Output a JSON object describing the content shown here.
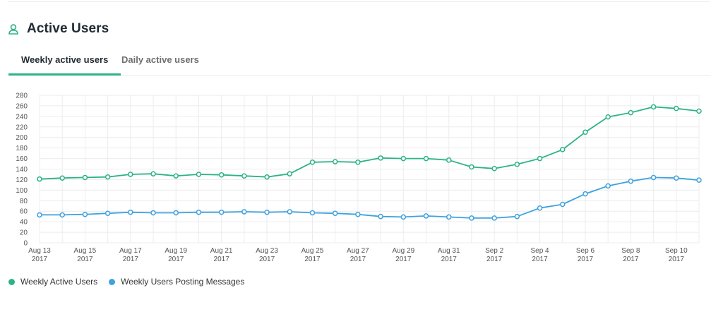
{
  "header": {
    "title": "Active Users",
    "icon": "user-icon"
  },
  "tabs": [
    {
      "label": "Weekly active users",
      "active": true
    },
    {
      "label": "Daily active users",
      "active": false
    }
  ],
  "colors": {
    "accent": "#2bb388",
    "series1": "#2bb388",
    "series2": "#3ea2dc"
  },
  "chart_data": {
    "type": "line",
    "ylim": [
      0,
      280
    ],
    "yticks": [
      0,
      20,
      40,
      60,
      80,
      100,
      120,
      140,
      160,
      180,
      200,
      220,
      240,
      260,
      280
    ],
    "grid": true,
    "legend": "bottom-left",
    "xlim": [
      "2017-08-13",
      "2017-09-11"
    ],
    "xticks": [
      {
        "date": "2017-08-13",
        "line1": "Aug 13",
        "line2": "2017"
      },
      {
        "date": "2017-08-15",
        "line1": "Aug 15",
        "line2": "2017"
      },
      {
        "date": "2017-08-17",
        "line1": "Aug 17",
        "line2": "2017"
      },
      {
        "date": "2017-08-19",
        "line1": "Aug 19",
        "line2": "2017"
      },
      {
        "date": "2017-08-21",
        "line1": "Aug 21",
        "line2": "2017"
      },
      {
        "date": "2017-08-23",
        "line1": "Aug 23",
        "line2": "2017"
      },
      {
        "date": "2017-08-25",
        "line1": "Aug 25",
        "line2": "2017"
      },
      {
        "date": "2017-08-27",
        "line1": "Aug 27",
        "line2": "2017"
      },
      {
        "date": "2017-08-29",
        "line1": "Aug 29",
        "line2": "2017"
      },
      {
        "date": "2017-08-31",
        "line1": "Aug 31",
        "line2": "2017"
      },
      {
        "date": "2017-09-02",
        "line1": "Sep 2",
        "line2": "2017"
      },
      {
        "date": "2017-09-04",
        "line1": "Sep 4",
        "line2": "2017"
      },
      {
        "date": "2017-09-06",
        "line1": "Sep 6",
        "line2": "2017"
      },
      {
        "date": "2017-09-08",
        "line1": "Sep 8",
        "line2": "2017"
      },
      {
        "date": "2017-09-10",
        "line1": "Sep 10",
        "line2": "2017"
      }
    ],
    "x": [
      "2017-08-13",
      "2017-08-14",
      "2017-08-15",
      "2017-08-16",
      "2017-08-17",
      "2017-08-18",
      "2017-08-19",
      "2017-08-20",
      "2017-08-21",
      "2017-08-22",
      "2017-08-23",
      "2017-08-24",
      "2017-08-25",
      "2017-08-26",
      "2017-08-27",
      "2017-08-28",
      "2017-08-29",
      "2017-08-30",
      "2017-08-31",
      "2017-09-01",
      "2017-09-02",
      "2017-09-03",
      "2017-09-04",
      "2017-09-05",
      "2017-09-06",
      "2017-09-07",
      "2017-09-08",
      "2017-09-09",
      "2017-09-10",
      "2017-09-11"
    ],
    "series": [
      {
        "name": "Weekly Active Users",
        "color": "#2bb388",
        "values": [
          121,
          123,
          124,
          125,
          130,
          131,
          127,
          130,
          129,
          127,
          125,
          131,
          153,
          154,
          153,
          161,
          160,
          160,
          157,
          144,
          141,
          149,
          160,
          177,
          210,
          239,
          247,
          258,
          255,
          250
        ]
      },
      {
        "name": "Weekly Users Posting Messages",
        "color": "#3ea2dc",
        "values": [
          53,
          53,
          54,
          56,
          58,
          57,
          57,
          58,
          58,
          59,
          58,
          59,
          57,
          56,
          54,
          50,
          49,
          51,
          49,
          47,
          47,
          50,
          66,
          73,
          93,
          108,
          117,
          124,
          123,
          119
        ]
      }
    ]
  }
}
